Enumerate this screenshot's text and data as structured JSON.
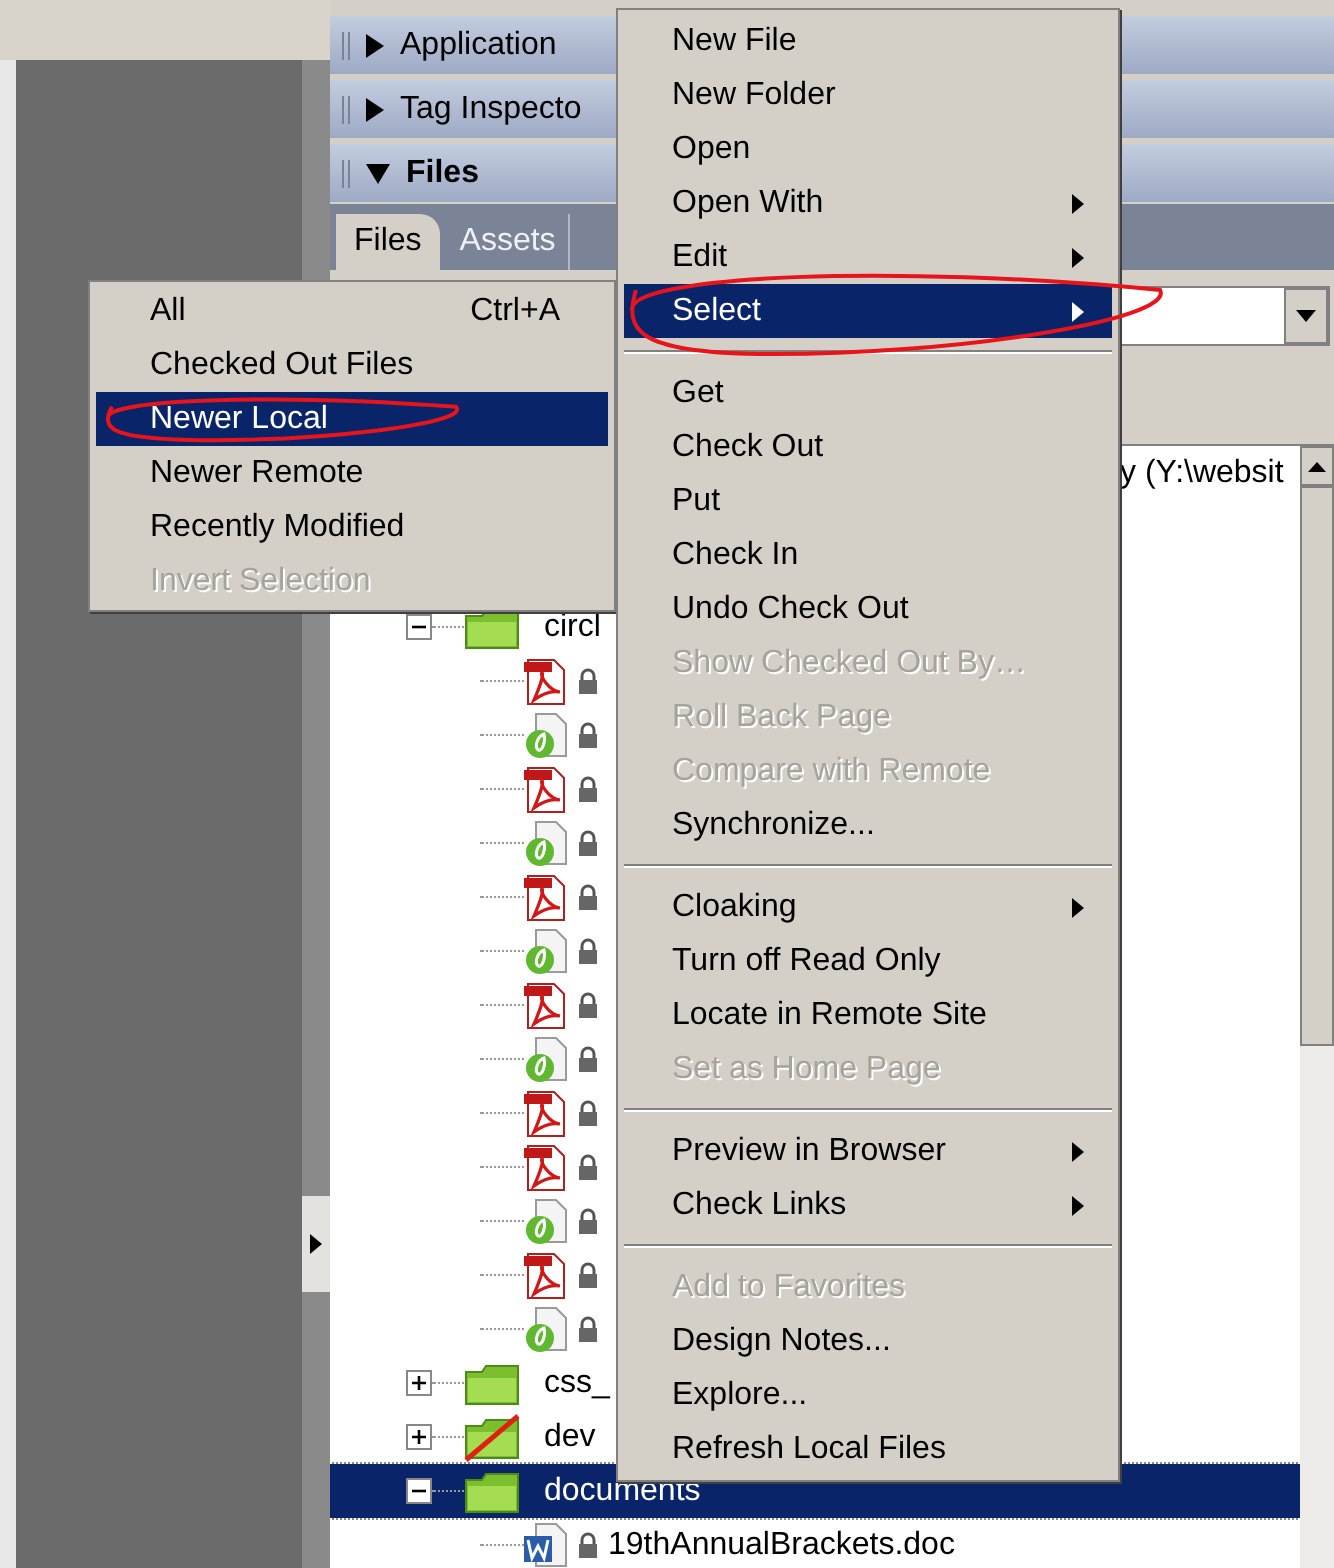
{
  "panels": [
    {
      "title": "Application",
      "expanded": false
    },
    {
      "title": "Tag Inspecto",
      "expanded": false
    },
    {
      "title": "Files",
      "expanded": true
    }
  ],
  "tabs": [
    {
      "label": "Files",
      "selected": true
    },
    {
      "label": "Assets",
      "selected": false
    }
  ],
  "tree": {
    "root_label": "y (Y:\\websit",
    "children": [
      {
        "kind": "folder",
        "name": "circl",
        "expanded": true,
        "children": [
          {
            "kind": "pdf",
            "locked": true
          },
          {
            "kind": "dw",
            "locked": true
          },
          {
            "kind": "pdf",
            "locked": true
          },
          {
            "kind": "dw",
            "locked": true
          },
          {
            "kind": "pdf",
            "locked": true
          },
          {
            "kind": "dw",
            "locked": true
          },
          {
            "kind": "pdf",
            "locked": true
          },
          {
            "kind": "dw",
            "locked": true
          },
          {
            "kind": "pdf",
            "locked": true
          },
          {
            "kind": "pdf",
            "locked": true
          },
          {
            "kind": "dw",
            "locked": true
          },
          {
            "kind": "pdf",
            "locked": true
          },
          {
            "kind": "dw",
            "locked": true
          }
        ]
      },
      {
        "kind": "folder",
        "name": "css_",
        "expanded": false
      },
      {
        "kind": "folder",
        "name": "dev",
        "expanded": false,
        "cloaked": true
      },
      {
        "kind": "folder",
        "name": "documents",
        "expanded": true,
        "selected": true,
        "children": [
          {
            "kind": "doc",
            "name": "19thAnnualBrackets.doc",
            "locked": true
          }
        ]
      }
    ]
  },
  "context_menu": {
    "items": [
      {
        "kind": "item",
        "label": "New File",
        "disabled": false,
        "submenu": false,
        "selected": false
      },
      {
        "kind": "item",
        "label": "New Folder",
        "disabled": false,
        "submenu": false,
        "selected": false
      },
      {
        "kind": "item",
        "label": "Open",
        "disabled": false,
        "submenu": false,
        "selected": false
      },
      {
        "kind": "item",
        "label": "Open With",
        "disabled": false,
        "submenu": true,
        "selected": false
      },
      {
        "kind": "item",
        "label": "Edit",
        "disabled": false,
        "submenu": true,
        "selected": false
      },
      {
        "kind": "item",
        "label": "Select",
        "disabled": false,
        "submenu": true,
        "selected": true,
        "circled": true
      },
      {
        "kind": "separator"
      },
      {
        "kind": "item",
        "label": "Get",
        "disabled": false,
        "submenu": false,
        "selected": false
      },
      {
        "kind": "item",
        "label": "Check Out",
        "disabled": false,
        "submenu": false,
        "selected": false
      },
      {
        "kind": "item",
        "label": "Put",
        "disabled": false,
        "submenu": false,
        "selected": false
      },
      {
        "kind": "item",
        "label": "Check In",
        "disabled": false,
        "submenu": false,
        "selected": false
      },
      {
        "kind": "item",
        "label": "Undo Check Out",
        "disabled": false,
        "submenu": false,
        "selected": false
      },
      {
        "kind": "item",
        "label": "Show Checked Out By…",
        "disabled": true,
        "submenu": false,
        "selected": false
      },
      {
        "kind": "item",
        "label": "Roll Back Page",
        "disabled": true,
        "submenu": false,
        "selected": false
      },
      {
        "kind": "item",
        "label": "Compare with Remote",
        "disabled": true,
        "submenu": false,
        "selected": false
      },
      {
        "kind": "item",
        "label": "Synchronize...",
        "disabled": false,
        "submenu": false,
        "selected": false
      },
      {
        "kind": "separator"
      },
      {
        "kind": "item",
        "label": "Cloaking",
        "disabled": false,
        "submenu": true,
        "selected": false
      },
      {
        "kind": "item",
        "label": "Turn off Read Only",
        "disabled": false,
        "submenu": false,
        "selected": false
      },
      {
        "kind": "item",
        "label": "Locate in Remote Site",
        "disabled": false,
        "submenu": false,
        "selected": false
      },
      {
        "kind": "item",
        "label": "Set as Home Page",
        "disabled": true,
        "submenu": false,
        "selected": false
      },
      {
        "kind": "separator"
      },
      {
        "kind": "item",
        "label": "Preview in Browser",
        "disabled": false,
        "submenu": true,
        "selected": false
      },
      {
        "kind": "item",
        "label": "Check Links",
        "disabled": false,
        "submenu": true,
        "selected": false
      },
      {
        "kind": "separator"
      },
      {
        "kind": "item",
        "label": "Add to Favorites",
        "disabled": true,
        "submenu": false,
        "selected": false
      },
      {
        "kind": "item",
        "label": "Design Notes...",
        "disabled": false,
        "submenu": false,
        "selected": false
      },
      {
        "kind": "item",
        "label": "Explore...",
        "disabled": false,
        "submenu": false,
        "selected": false
      },
      {
        "kind": "item",
        "label": "Refresh Local Files",
        "disabled": false,
        "submenu": false,
        "selected": false
      }
    ]
  },
  "select_submenu": {
    "items": [
      {
        "kind": "item",
        "label": "All",
        "shortcut": "Ctrl+A",
        "disabled": false,
        "selected": false
      },
      {
        "kind": "item",
        "label": "Checked Out Files",
        "disabled": false,
        "selected": false
      },
      {
        "kind": "item",
        "label": "Newer Local",
        "disabled": false,
        "selected": true,
        "circled": true
      },
      {
        "kind": "item",
        "label": "Newer Remote",
        "disabled": false,
        "selected": false
      },
      {
        "kind": "item",
        "label": "Recently Modified",
        "disabled": false,
        "selected": false
      },
      {
        "kind": "item",
        "label": "Invert Selection",
        "disabled": true,
        "selected": false
      }
    ]
  }
}
